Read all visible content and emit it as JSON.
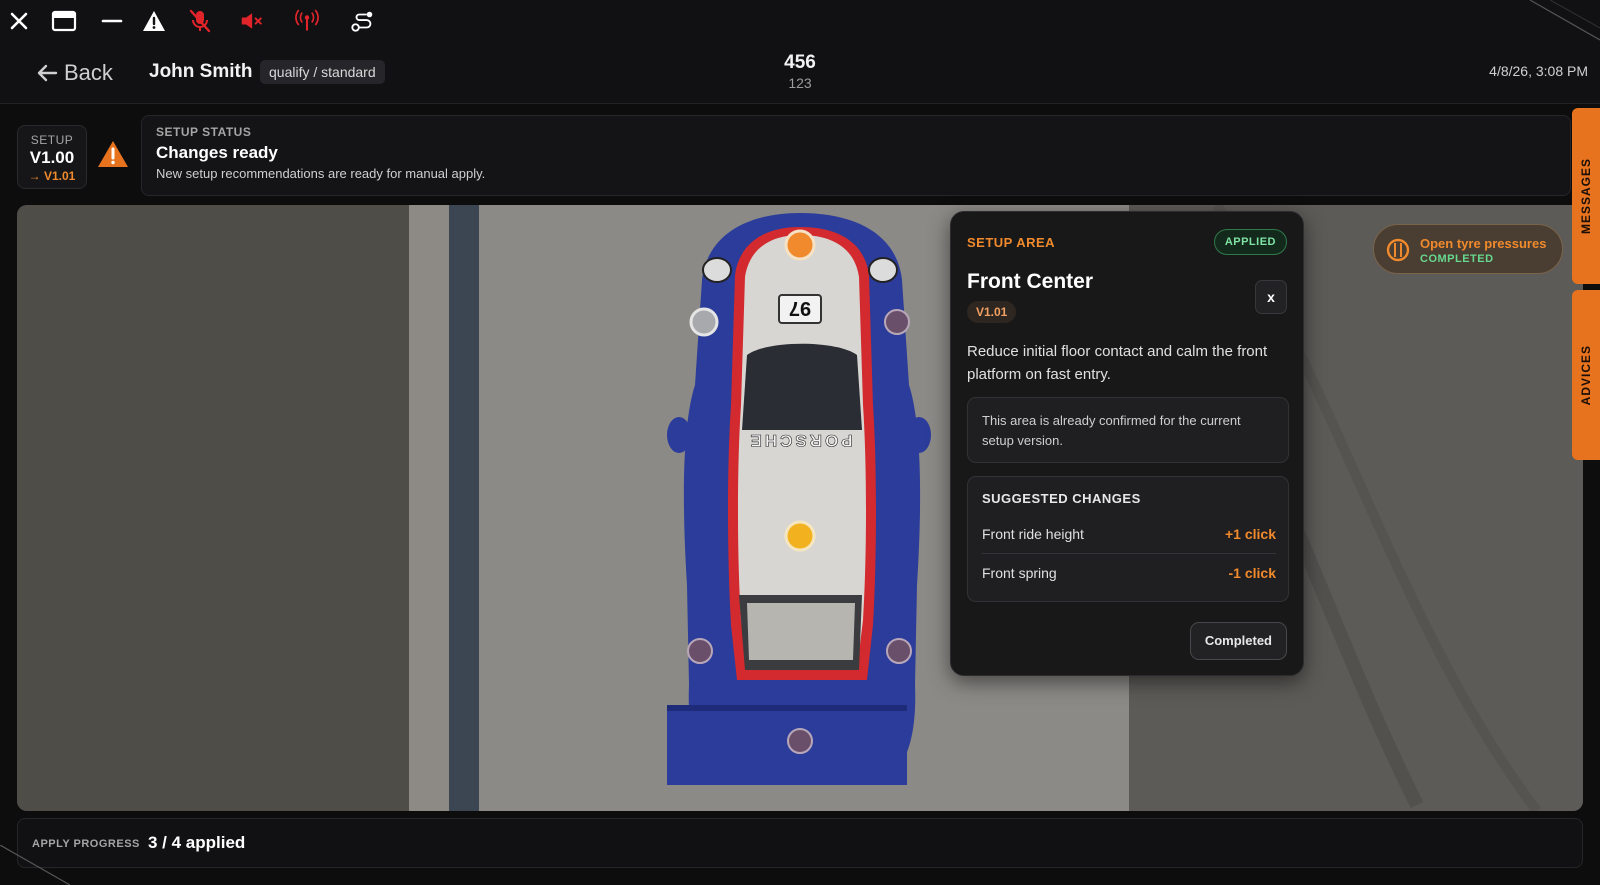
{
  "toolbar": {
    "icons": [
      "close-icon",
      "window-icon",
      "minimize-icon",
      "warning-icon",
      "mic-muted-icon",
      "speaker-muted-icon",
      "antenna-icon",
      "route-icon"
    ],
    "accent_red": "#e0242a"
  },
  "header": {
    "back_label": "Back",
    "driver_name": "John Smith",
    "session": "qualify / standard",
    "center_main": "456",
    "center_sub": "123",
    "datetime": "4/8/26, 3:08 PM"
  },
  "setup": {
    "label": "SETUP",
    "current_version": "V1.00",
    "next_version": "→ V1.01"
  },
  "status": {
    "label": "SETUP STATUS",
    "title": "Changes ready",
    "description": "New setup recommendations are ready for manual apply."
  },
  "side_tabs": {
    "messages": "MESSAGES",
    "advices": "ADVICES"
  },
  "car": {
    "number": "97",
    "brand": "PORSCHE"
  },
  "panel": {
    "label": "SETUP AREA",
    "badge": "APPLIED",
    "title": "Front Center",
    "version": "V1.01",
    "close_label": "x",
    "description": "Reduce initial floor contact and calm the front platform on fast entry.",
    "note": "This area is already confirmed for the current setup version.",
    "changes_title": "SUGGESTED CHANGES",
    "changes": [
      {
        "name": "Front ride height",
        "value": "+1 click"
      },
      {
        "name": "Front spring",
        "value": "-1 click"
      }
    ],
    "completed_label": "Completed"
  },
  "tyre": {
    "title": "Open tyre pressures",
    "status": "COMPLETED"
  },
  "progress": {
    "label": "APPLY PROGRESS",
    "value": "3 / 4 applied"
  },
  "colors": {
    "accent": "#f08a2c",
    "success": "#67d98e",
    "car_blue": "#2b3c9a",
    "car_red": "#d22a2e"
  }
}
